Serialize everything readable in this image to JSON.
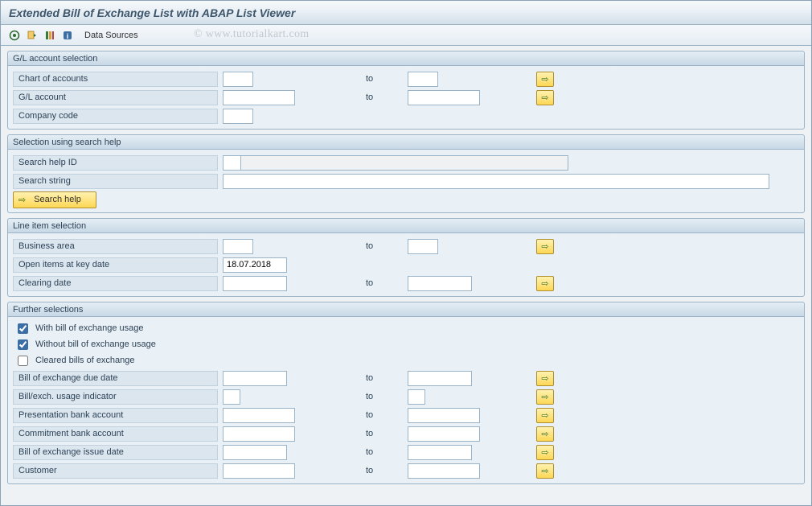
{
  "title": "Extended Bill of Exchange List with ABAP List Viewer",
  "toolbar": {
    "data_sources": "Data Sources"
  },
  "watermark": "© www.tutorialkart.com",
  "groups": {
    "gl": {
      "title": "G/L account selection",
      "chart_of_accounts": "Chart of accounts",
      "gl_account": "G/L account",
      "company_code": "Company code",
      "to": "to"
    },
    "search": {
      "title": "Selection using search help",
      "search_help_id": "Search help ID",
      "search_string": "Search string",
      "button": "Search help"
    },
    "line": {
      "title": "Line item selection",
      "business_area": "Business area",
      "open_items": "Open items at key date",
      "open_items_value": "18.07.2018",
      "clearing_date": "Clearing date",
      "to": "to"
    },
    "further": {
      "title": "Further selections",
      "chk_with": "With bill of exchange usage",
      "chk_without": "Without bill of exchange usage",
      "chk_cleared": "Cleared bills of exchange",
      "due_date": "Bill of exchange due date",
      "usage_ind": "Bill/exch. usage indicator",
      "pres_bank": "Presentation bank account",
      "commit_bank": "Commitment bank account",
      "issue_date": "Bill of exchange issue date",
      "customer": "Customer",
      "to": "to"
    }
  }
}
